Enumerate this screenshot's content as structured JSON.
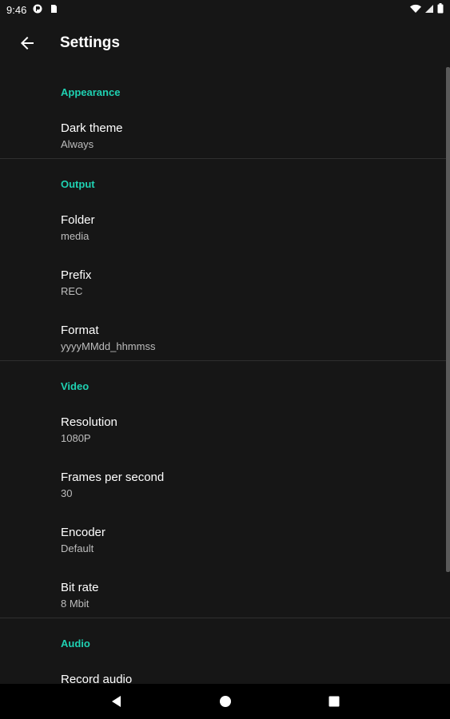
{
  "status_bar": {
    "time": "9:46"
  },
  "app_bar": {
    "title": "Settings",
    "back_icon": "arrow-back-icon"
  },
  "colors": {
    "accent": "#1fd1b2",
    "background": "#161616",
    "summary": "#bdbdbd"
  },
  "sections": {
    "appearance": {
      "header": "Appearance",
      "items": [
        {
          "title": "Dark theme",
          "summary": "Always"
        }
      ]
    },
    "output": {
      "header": "Output",
      "items": [
        {
          "title": "Folder",
          "summary": "media"
        },
        {
          "title": "Prefix",
          "summary": "REC"
        },
        {
          "title": "Format",
          "summary": "yyyyMMdd_hhmmss"
        }
      ]
    },
    "video": {
      "header": "Video",
      "items": [
        {
          "title": "Resolution",
          "summary": "1080P"
        },
        {
          "title": "Frames per second",
          "summary": "30"
        },
        {
          "title": "Encoder",
          "summary": "Default"
        },
        {
          "title": "Bit rate",
          "summary": "8 Mbit"
        }
      ]
    },
    "audio": {
      "header": "Audio",
      "items": [
        {
          "title": "Record audio"
        }
      ]
    }
  },
  "nav_bar": {
    "back": "nav-back-icon",
    "home": "nav-home-icon",
    "recents": "nav-recents-icon"
  }
}
